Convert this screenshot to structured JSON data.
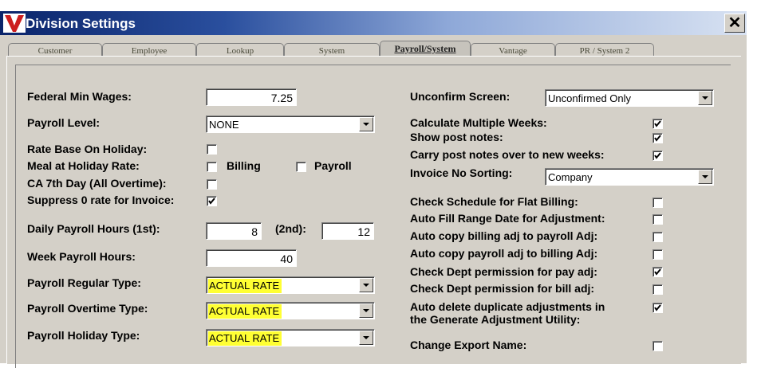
{
  "window": {
    "title": "Division Settings",
    "close_glyph": "✕"
  },
  "tabs": [
    "Customer",
    "Employee",
    "Lookup",
    "System",
    "Payroll/System",
    "Vantage",
    "PR / System 2"
  ],
  "active_tab": "Payroll/System",
  "left": {
    "federal_min_wages": {
      "label": "Federal Min Wages:",
      "value": "7.25"
    },
    "payroll_level": {
      "label": "Payroll Level:",
      "value": "NONE"
    },
    "rate_base_on_holiday": {
      "label": "Rate Base On Holiday:",
      "checked": false
    },
    "meal_at_holiday_rate": {
      "label": "Meal at Holiday Rate:",
      "billing_label": "Billing",
      "billing_checked": false,
      "payroll_label": "Payroll",
      "payroll_checked": false
    },
    "ca_7th_day": {
      "label": "CA 7th Day (All Overtime):",
      "checked": false
    },
    "suppress_0_rate": {
      "label": "Suppress 0 rate for Invoice:",
      "checked": true
    },
    "daily_payroll_hours": {
      "label": "Daily Payroll Hours (1st):",
      "value_1st": "8",
      "label_2nd": "(2nd):",
      "value_2nd": "12"
    },
    "week_payroll_hours": {
      "label": "Week Payroll Hours:",
      "value": "40"
    },
    "payroll_regular_type": {
      "label": "Payroll Regular Type:",
      "value": "ACTUAL RATE"
    },
    "payroll_overtime_type": {
      "label": "Payroll Overtime Type:",
      "value": "ACTUAL RATE"
    },
    "payroll_holiday_type": {
      "label": "Payroll Holiday Type:",
      "value": "ACTUAL RATE"
    }
  },
  "right": {
    "unconfirm_screen": {
      "label": "Unconfirm Screen:",
      "value": "Unconfirmed Only"
    },
    "calc_multiple_weeks": {
      "label": "Calculate Multiple Weeks:",
      "checked": true
    },
    "show_post_notes": {
      "label": "Show post notes:",
      "checked": true
    },
    "carry_post_notes": {
      "label": "Carry post notes over to new weeks:",
      "checked": true
    },
    "invoice_no_sorting": {
      "label": "Invoice No Sorting:",
      "value": "Company"
    },
    "check_schedule_flat": {
      "label": "Check Schedule for Flat Billing:",
      "checked": false
    },
    "auto_fill_range": {
      "label": "Auto Fill Range Date for Adjustment:",
      "checked": false
    },
    "auto_copy_billing": {
      "label": "Auto copy billing adj to payroll Adj:",
      "checked": false
    },
    "auto_copy_payroll": {
      "label": "Auto copy payroll adj to billing Adj:",
      "checked": false
    },
    "check_dept_pay": {
      "label": "Check Dept permission for pay adj:",
      "checked": true
    },
    "check_dept_bill": {
      "label": "Check Dept permission for bill adj:",
      "checked": false
    },
    "auto_delete_dup": {
      "label_line1": "Auto delete duplicate adjustments in",
      "label_line2": "the Generate Adjustment Utility:",
      "checked": true
    },
    "change_export_name": {
      "label": "Change Export Name:",
      "checked": false
    }
  },
  "colors": {
    "highlight": "#ffff33",
    "titlebar": "#0a246a",
    "face": "#d4d0c8",
    "logo_red": "#cc1f1f"
  }
}
